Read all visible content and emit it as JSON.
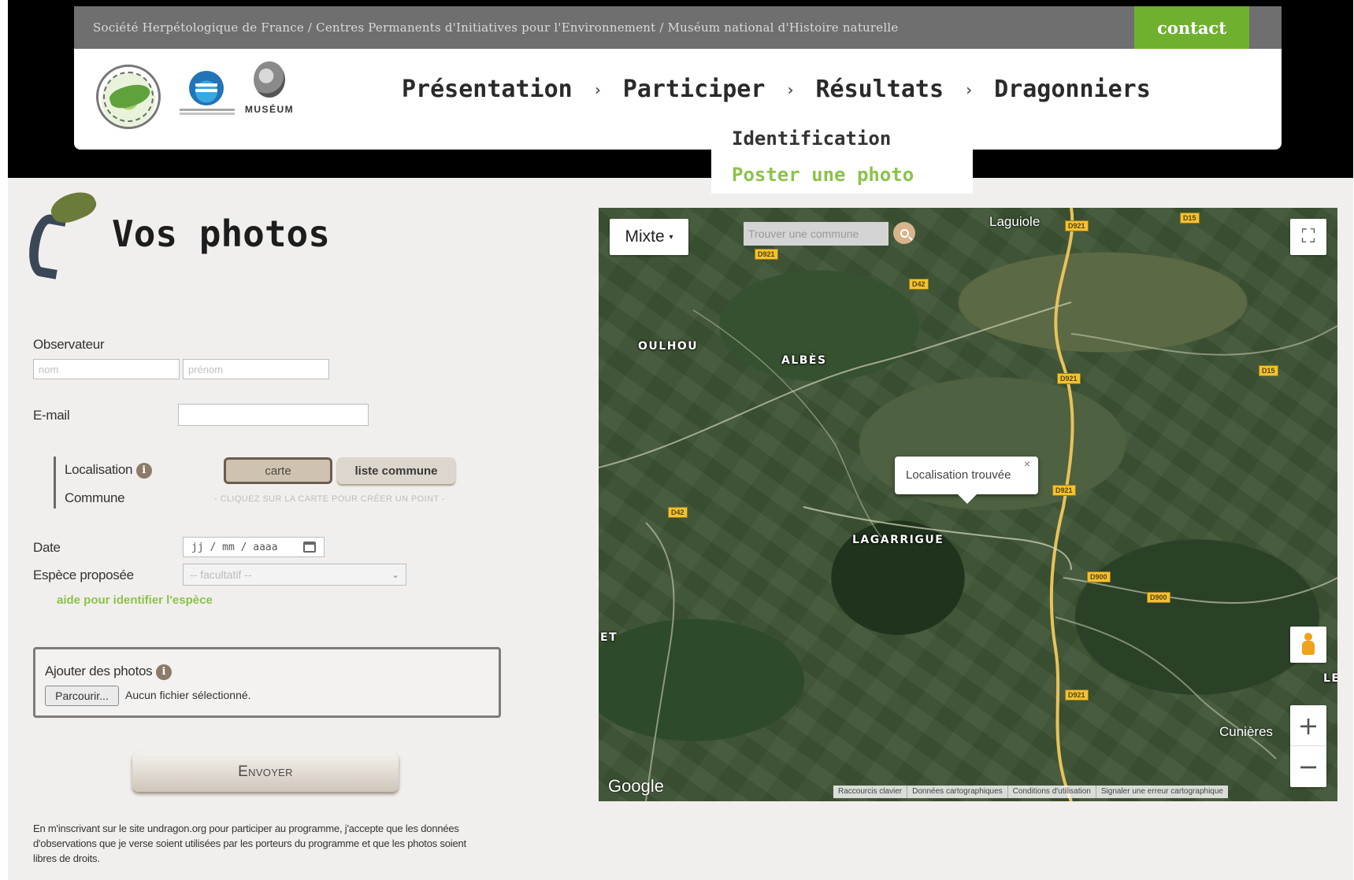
{
  "topbar": {
    "partners_text": "Société Herpétologique de France / Centres Permanents d'Initiatives pour l'Environnement / Muséum national d'Histoire naturelle",
    "contact_label": "contact"
  },
  "header": {
    "logos": [
      "SHF",
      "CPIE",
      "MUSÉUM"
    ],
    "museum_word": "MUSÉUM",
    "nav": [
      {
        "label": "Présentation"
      },
      {
        "label": "Participer"
      },
      {
        "label": "Résultats"
      },
      {
        "label": "Dragonniers"
      }
    ],
    "nav_separator": "›",
    "submenu": {
      "identification": "Identification",
      "poster": "Poster une photo"
    }
  },
  "form": {
    "title": "Vos photos",
    "observer_label": "Observateur",
    "nom_placeholder": "nom",
    "prenom_placeholder": "prénom",
    "email_label": "E-mail",
    "localisation_label": "Localisation",
    "commune_label": "Commune",
    "info_glyph": "i",
    "carte_label": "carte",
    "liste_label": "liste commune",
    "map_hint": "- CLIQUEZ SUR LA CARTE POUR CRÉER UN POINT -",
    "date_label": "Date",
    "date_placeholder": "jj / mm / aaaa",
    "species_label": "Espèce proposée",
    "species_selected": "-- facultatif --",
    "help_link": "aide pour identifier l'espèce",
    "photos_label": "Ajouter des photos",
    "browse_label": "Parcourir...",
    "no_file": "Aucun fichier sélectionné.",
    "send_label": "Envoyer",
    "disclaimer": "En m'inscrivant sur le site undragon.org pour participer au programme, j'accepte que les données d'observations que je verse soient utilisées par les porteurs du programme et que les photos soient libres de droits."
  },
  "map": {
    "type_label": "Mixte",
    "type_chevron": "▾",
    "search_placeholder": "Trouver une commune",
    "fullscreen_glyph": "⛶",
    "zoom_in": "+",
    "zoom_out": "−",
    "places": {
      "laguiole": "Laguiole",
      "oulhou": "OULHOU",
      "albes": "ALBÈS",
      "lagarrigue": "LAGARRIGUE",
      "cunieres": "Cunières",
      "et": "ET",
      "le": "LE"
    },
    "road_badges": [
      "D921",
      "D921",
      "D42",
      "D15",
      "D15",
      "D921",
      "D921",
      "D42",
      "D900",
      "D900",
      "D921"
    ],
    "info_window_text": "Localisation trouvée",
    "info_close": "×",
    "google_logo": "Google",
    "footer": [
      "Raccourcis clavier",
      "Données cartographiques",
      "Conditions d'utilisation",
      "Signaler une erreur cartographique"
    ]
  }
}
